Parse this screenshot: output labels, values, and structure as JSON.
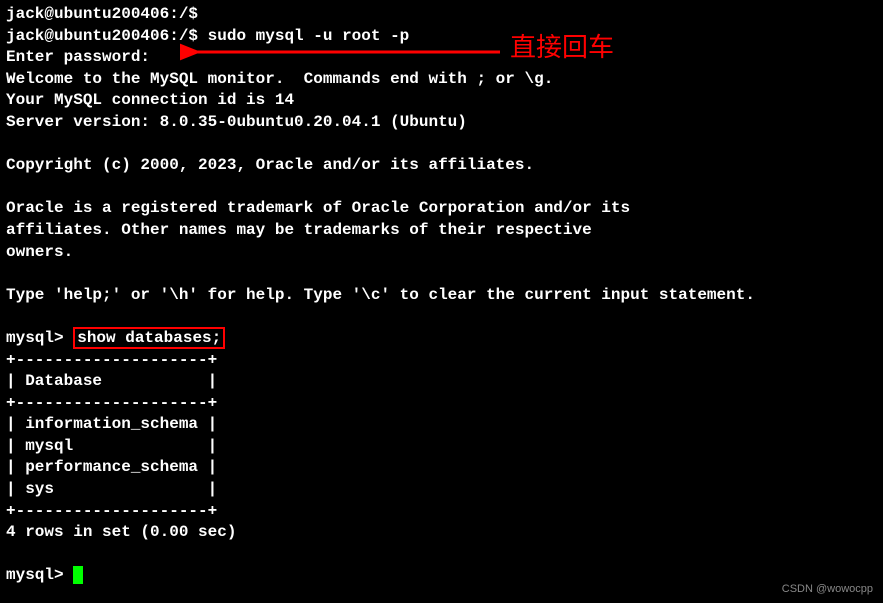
{
  "terminal": {
    "prompt1": "jack@ubuntu200406:/$",
    "prompt2_user": "jack@ubuntu200406:/$ ",
    "command": "sudo mysql -u root -p",
    "enter_password": "Enter password:",
    "welcome": "Welcome to the MySQL monitor.  Commands end with ; or \\g.",
    "connection_id": "Your MySQL connection id is 14",
    "server_version": "Server version: 8.0.35-0ubuntu0.20.04.1 (Ubuntu)",
    "copyright": "Copyright (c) 2000, 2023, Oracle and/or its affiliates.",
    "trademark1": "Oracle is a registered trademark of Oracle Corporation and/or its",
    "trademark2": "affiliates. Other names may be trademarks of their respective",
    "trademark3": "owners.",
    "help_line": "Type 'help;' or '\\h' for help. Type '\\c' to clear the current input statement.",
    "mysql_prompt": "mysql> ",
    "show_cmd": "show databases;",
    "table_border": "+--------------------+",
    "table_header": "| Database           |",
    "row1": "| information_schema |",
    "row2": "| mysql              |",
    "row3": "| performance_schema |",
    "row4": "| sys                |",
    "result": "4 rows in set (0.00 sec)"
  },
  "annotation": {
    "text": "直接回车"
  },
  "watermark": "CSDN @wowocpp"
}
